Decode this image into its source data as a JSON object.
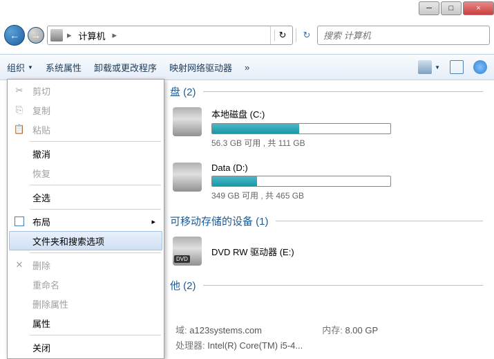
{
  "window_controls": {
    "min": "─",
    "max": "□",
    "close": "×"
  },
  "nav": {
    "location_segments": [
      "计算机"
    ],
    "search_placeholder": "搜索 计算机"
  },
  "toolbar": {
    "organize": "组织",
    "system_props": "系统属性",
    "uninstall": "卸载或更改程序",
    "map_drive": "映射网络驱动器",
    "more": "»"
  },
  "menu": {
    "cut": "剪切",
    "copy": "复制",
    "paste": "粘贴",
    "undo": "撤消",
    "redo": "恢复",
    "select_all": "全选",
    "layout": "布局",
    "folder_options": "文件夹和搜索选项",
    "delete": "删除",
    "rename": "重命名",
    "remove_props": "删除属性",
    "properties": "属性",
    "close": "关闭"
  },
  "content": {
    "section_hdd": "盘 (2)",
    "section_removable": "可移动存储的设备 (1)",
    "section_other": "他 (2)",
    "drives": [
      {
        "name": "本地磁盘 (C:)",
        "stats": "56.3 GB 可用 , 共 111 GB",
        "fill_pct": 49
      },
      {
        "name": "Data (D:)",
        "stats": "349 GB 可用 , 共 465 GB",
        "fill_pct": 25
      }
    ],
    "dvd": {
      "name": "DVD RW 驱动器 (E:)"
    }
  },
  "footer": {
    "domain_label": "域:",
    "domain_value": "a123systems.com",
    "memory_label": "内存:",
    "memory_value": "8.00 GP",
    "cpu_label": "处理器:",
    "cpu_value": "Intel(R) Core(TM) i5-4..."
  }
}
